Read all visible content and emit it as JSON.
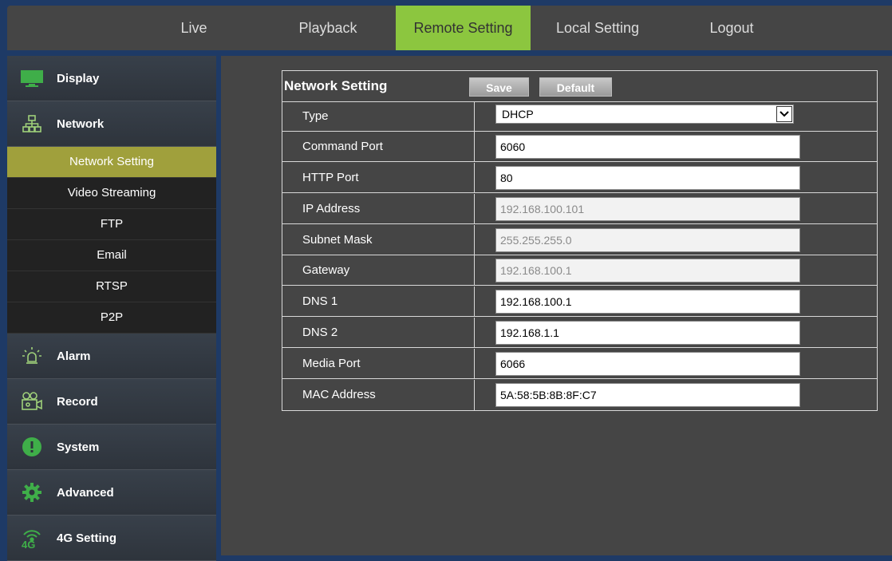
{
  "nav": {
    "items": [
      {
        "label": "Live"
      },
      {
        "label": "Playback"
      },
      {
        "label": "Remote Setting"
      },
      {
        "label": "Local Setting"
      },
      {
        "label": "Logout"
      }
    ],
    "active": "Remote Setting"
  },
  "sidebar": {
    "display": {
      "label": "Display",
      "icon": "monitor-icon"
    },
    "network": {
      "label": "Network",
      "icon": "network-icon"
    },
    "network_sub": [
      {
        "label": "Network Setting"
      },
      {
        "label": "Video Streaming"
      },
      {
        "label": "FTP"
      },
      {
        "label": "Email"
      },
      {
        "label": "RTSP"
      },
      {
        "label": "P2P"
      }
    ],
    "alarm": {
      "label": "Alarm",
      "icon": "alarm-light-icon"
    },
    "record": {
      "label": "Record",
      "icon": "video-camera-icon"
    },
    "system": {
      "label": "System",
      "icon": "exclamation-icon"
    },
    "advanced": {
      "label": "Advanced",
      "icon": "gear-icon"
    },
    "g4": {
      "label": "4G Setting",
      "icon": "4g-signal-icon",
      "badge": "4G"
    }
  },
  "panel": {
    "title": "Network Setting",
    "save_label": "Save",
    "default_label": "Default",
    "rows": {
      "type": {
        "label": "Type",
        "value": "DHCP"
      },
      "command_port": {
        "label": "Command Port",
        "value": "6060"
      },
      "http_port": {
        "label": "HTTP Port",
        "value": "80"
      },
      "ip_address": {
        "label": "IP Address",
        "value": "192.168.100.101"
      },
      "subnet_mask": {
        "label": "Subnet Mask",
        "value": "255.255.255.0"
      },
      "gateway": {
        "label": "Gateway",
        "value": "192.168.100.1"
      },
      "dns1": {
        "label": "DNS 1",
        "value": "192.168.100.1"
      },
      "dns2": {
        "label": "DNS 2",
        "value": "192.168.1.1"
      },
      "media_port": {
        "label": "Media Port",
        "value": "6066"
      },
      "mac_address": {
        "label": "MAC Address",
        "value": "5A:58:5B:8B:8F:C7"
      }
    }
  },
  "colors": {
    "accent": "#8cc63f",
    "sub_active": "#a0a03c",
    "frame": "#1e3a66"
  }
}
